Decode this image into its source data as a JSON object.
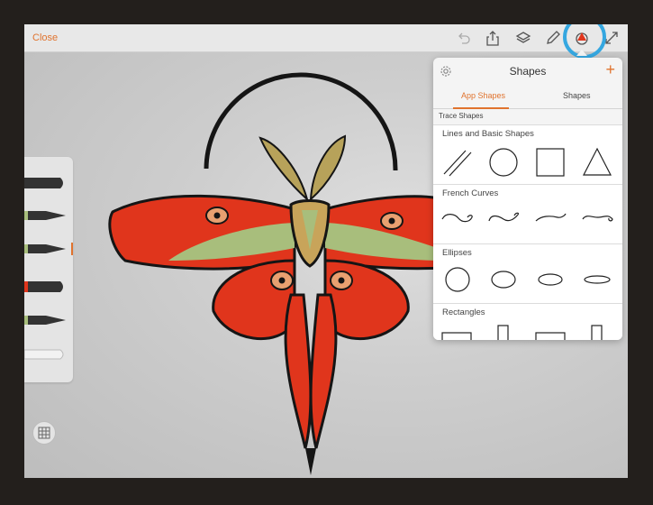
{
  "toolbar": {
    "close_label": "Close",
    "icons": [
      "undo-icon",
      "share-icon",
      "layers-icon",
      "pencil-icon",
      "shapes-icon",
      "fullscreen-icon"
    ]
  },
  "shapes_panel": {
    "title": "Shapes",
    "add_label": "+",
    "tabs": [
      {
        "label": "App Shapes",
        "active": true
      },
      {
        "label": "Shapes",
        "active": false
      }
    ],
    "section_label": "Trace Shapes",
    "categories": [
      {
        "label": "Lines and Basic Shapes",
        "items": [
          "lines",
          "circle",
          "square",
          "triangle"
        ]
      },
      {
        "label": "French Curves",
        "items": [
          "curve-1",
          "curve-2",
          "curve-3",
          "curve-4"
        ]
      },
      {
        "label": "Ellipses",
        "items": [
          "circle",
          "ellipse-wide",
          "ellipse-wider",
          "ellipse-flat"
        ]
      },
      {
        "label": "Rectangles",
        "items": [
          "rect-wide",
          "rect-tall",
          "rect-wide-2",
          "rect-tall-2"
        ]
      }
    ]
  },
  "colors": {
    "accent": "#e0732e",
    "highlight": "#35a7e0",
    "moth_red": "#e0351c",
    "moth_green": "#a8be7c",
    "moth_gold": "#c8a45a"
  }
}
